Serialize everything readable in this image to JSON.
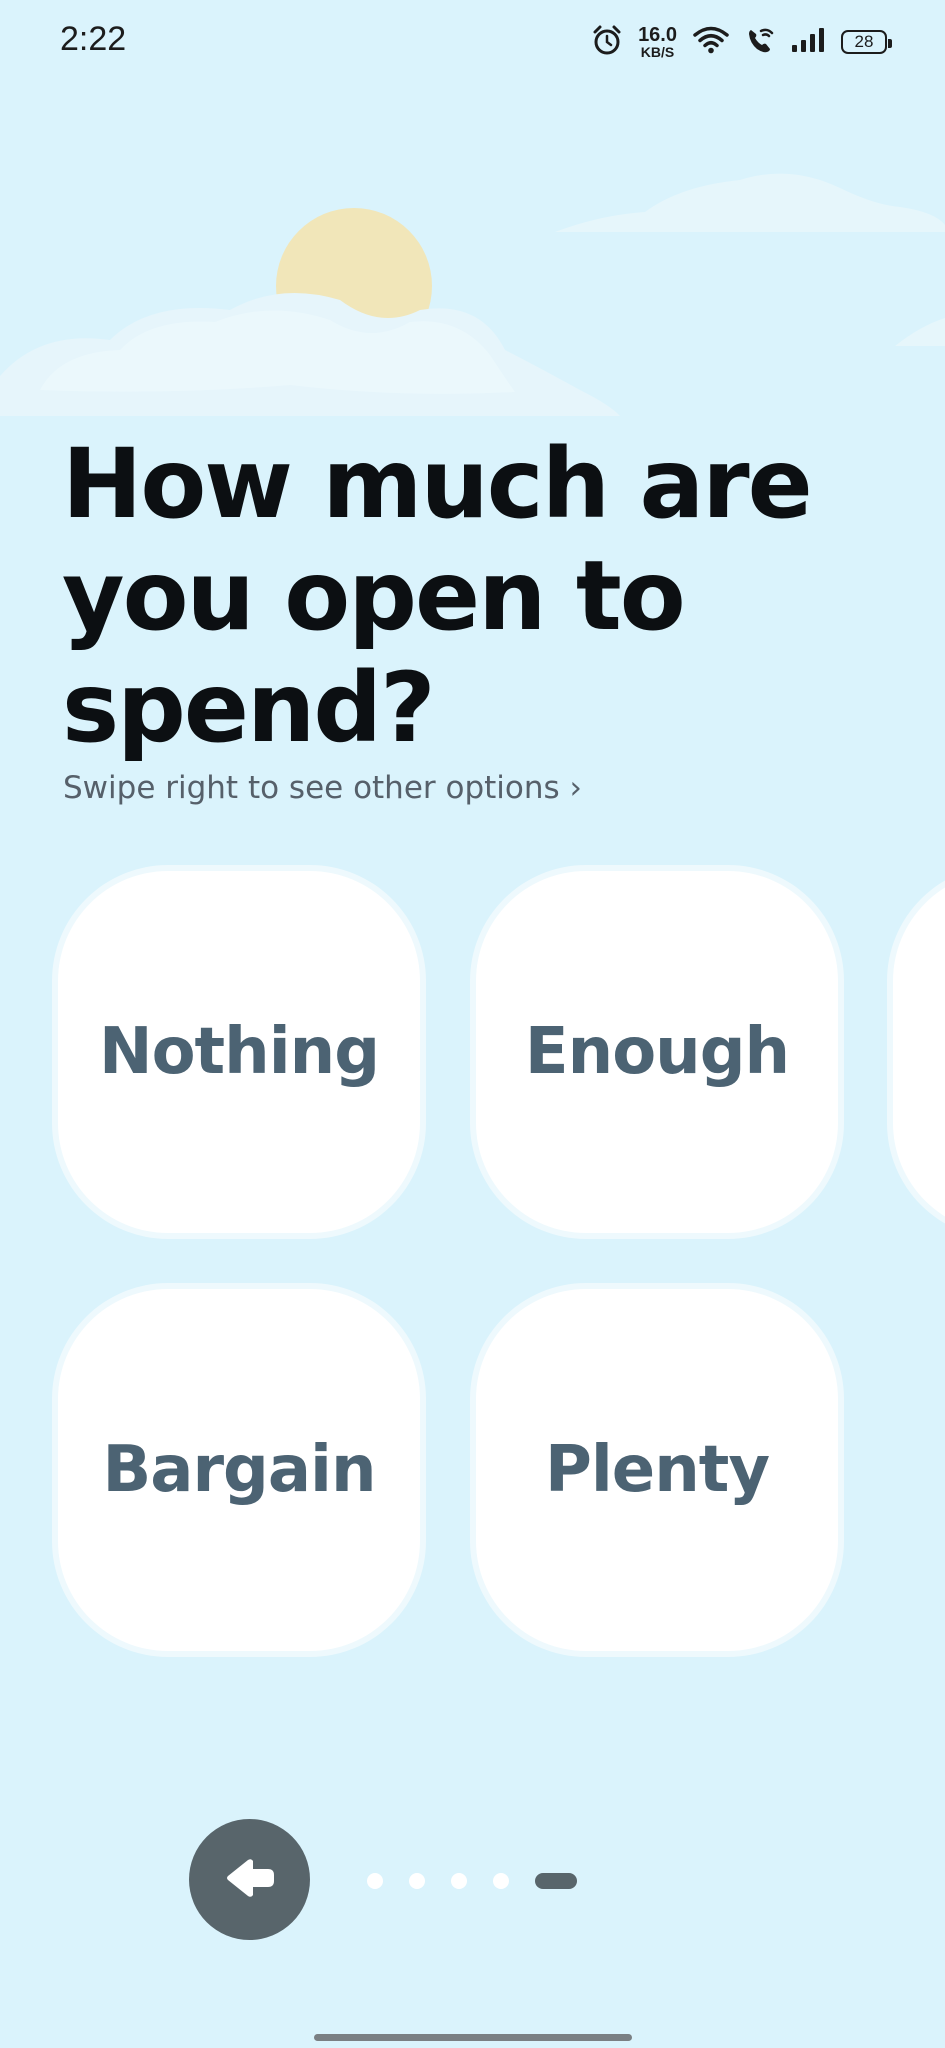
{
  "status_bar": {
    "time": "2:22",
    "network_speed_value": "16.0",
    "network_speed_unit": "KB/S",
    "battery_level": "28",
    "icons": [
      "alarm-icon",
      "wifi-icon",
      "wifi-calling-icon",
      "signal-icon",
      "battery-icon"
    ]
  },
  "question": {
    "title": "How much are you open to spend?",
    "hint": "Swipe right to see other options ›"
  },
  "options": [
    {
      "label": "Nothing"
    },
    {
      "label": "Enough"
    },
    {
      "label": "Bargain"
    },
    {
      "label": "Plenty"
    }
  ],
  "navigation": {
    "back_icon": "arrow-left-icon",
    "page_count": 5,
    "current_page": 5
  },
  "colors": {
    "background": "#daf3fc",
    "card": "#ffffff",
    "card_text": "#4c6373",
    "title_text": "#0c0f12",
    "accent_dark": "#58656b",
    "sun": "#f1e6b9",
    "cloud": "#e8f6fb"
  }
}
